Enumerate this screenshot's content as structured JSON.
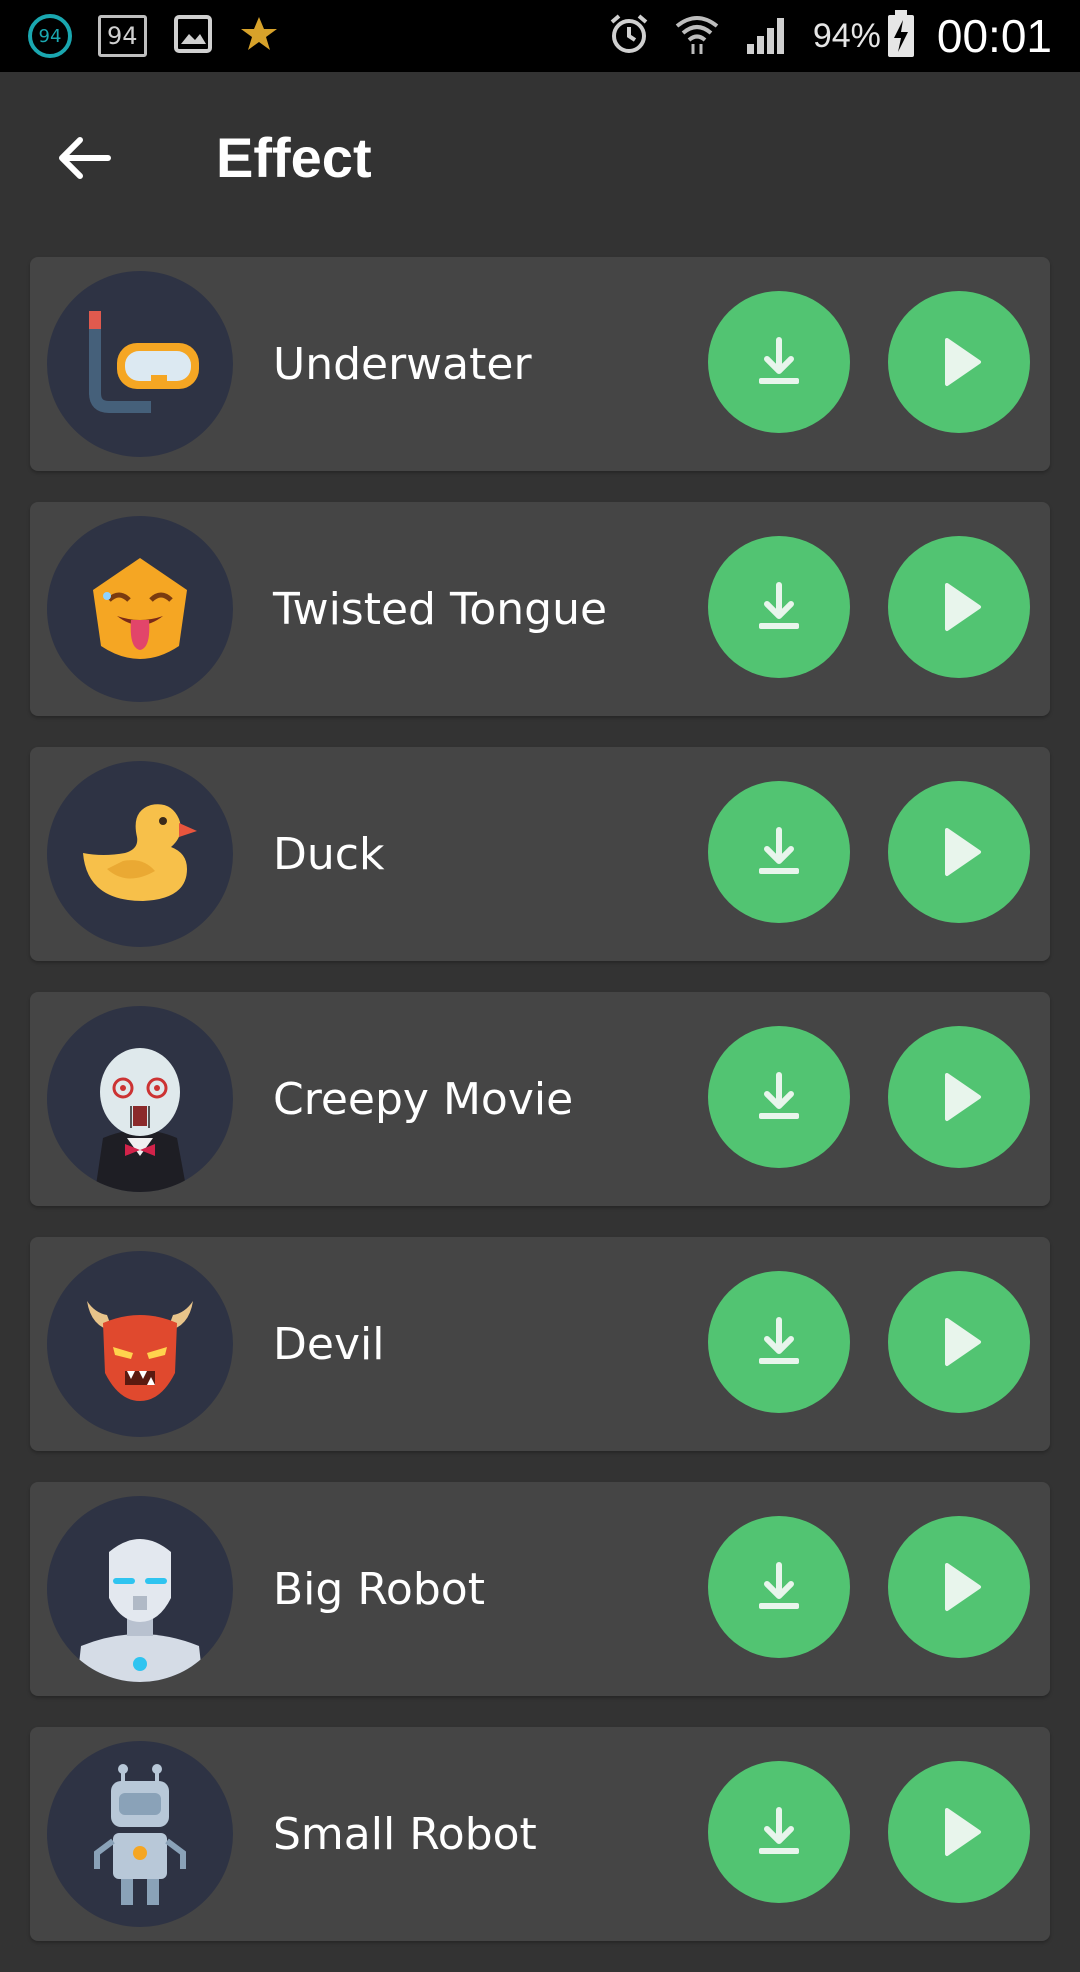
{
  "status_bar": {
    "badge_circle": "94",
    "badge_box": "94",
    "battery_percent": "94%",
    "time": "00:01",
    "icons": [
      "image-icon",
      "star-icon",
      "alarm-icon",
      "wifi-icon",
      "signal-icon",
      "battery-charging-icon"
    ]
  },
  "header": {
    "title": "Effect",
    "back_icon": "arrow-left-icon"
  },
  "effects": [
    {
      "label": "Underwater",
      "icon": "snorkel-mask-icon"
    },
    {
      "label": "Twisted Tongue",
      "icon": "tongue-face-icon"
    },
    {
      "label": "Duck",
      "icon": "duck-icon"
    },
    {
      "label": "Creepy Movie",
      "icon": "creepy-puppet-icon"
    },
    {
      "label": "Devil",
      "icon": "devil-icon"
    },
    {
      "label": "Big Robot",
      "icon": "big-robot-icon"
    },
    {
      "label": "Small Robot",
      "icon": "small-robot-icon"
    }
  ],
  "colors": {
    "background": "#333333",
    "card": "#454545",
    "avatar_bg": "#2e3344",
    "accent_green": "#52c472"
  }
}
